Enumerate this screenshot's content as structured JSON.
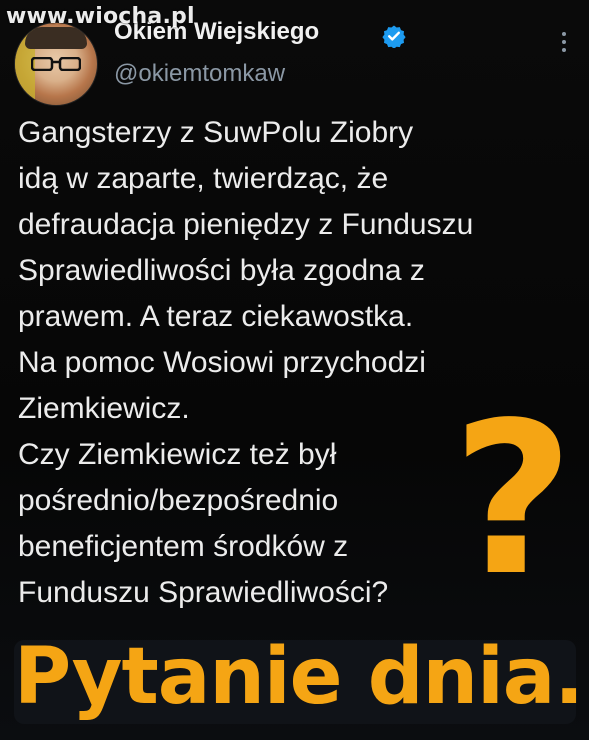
{
  "watermark": "www.wiocha.pl",
  "author": {
    "display_name": "Okiem Wiejskiego",
    "handle": "@okiemtomkaw",
    "verified": true
  },
  "tweet": {
    "lines": [
      "Gangsterzy z SuwPolu Ziobry",
      "idą w zaparte, twierdząc, że",
      "defraudacja pieniędzy z Funduszu",
      "Sprawiedliwości była zgodna z",
      "prawem. A teraz ciekawostka.",
      "Na pomoc Wosiowi przychodzi",
      "Ziemkiewicz.",
      "Czy Ziemkiewicz też był",
      "pośrednio/bezpośrednio",
      "beneficjentem środków z",
      "Funduszu Sprawiedliwości?"
    ]
  },
  "overlay": {
    "question_mark": "?",
    "banner": "Pytanie dnia."
  },
  "colors": {
    "background": "#000000",
    "text": "#ececec",
    "handle": "#8b98a5",
    "accent_orange": "#f5a514",
    "verified_blue": "#1d9bf0"
  },
  "icons": {
    "verified": "verified-badge-icon",
    "more": "more-options-icon"
  }
}
